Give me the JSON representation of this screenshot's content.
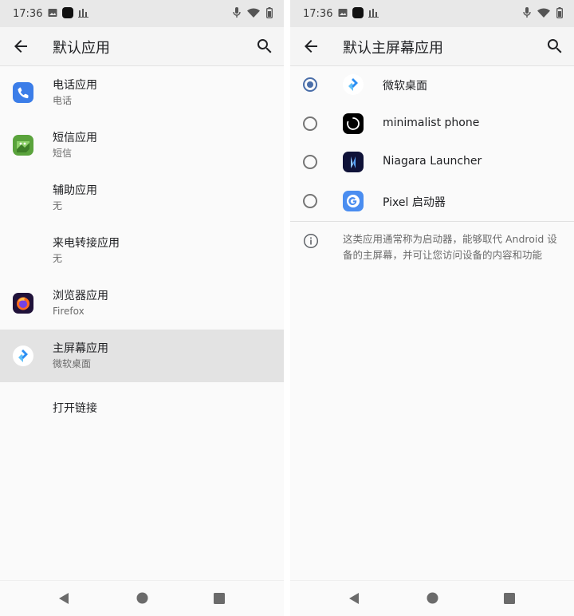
{
  "status_bar": {
    "time": "17:36"
  },
  "left": {
    "title": "默认应用",
    "items": [
      {
        "primary": "电话应用",
        "secondary": "电话",
        "icon": "phone-app-icon"
      },
      {
        "primary": "短信应用",
        "secondary": "短信",
        "icon": "messages-app-icon"
      },
      {
        "primary": "辅助应用",
        "secondary": "无"
      },
      {
        "primary": "来电转接应用",
        "secondary": "无"
      },
      {
        "primary": "浏览器应用",
        "secondary": "Firefox",
        "icon": "firefox-icon"
      },
      {
        "primary": "主屏幕应用",
        "secondary": "微软桌面",
        "icon": "microsoft-launcher-icon",
        "selected": true
      },
      {
        "primary": "打开链接"
      }
    ]
  },
  "right": {
    "title": "默认主屏幕应用",
    "options": [
      {
        "label": "微软桌面",
        "checked": true,
        "icon": "microsoft-launcher-icon"
      },
      {
        "label": "minimalist phone",
        "checked": false,
        "icon": "minimalist-phone-icon"
      },
      {
        "label": "Niagara Launcher",
        "checked": false,
        "icon": "niagara-launcher-icon"
      },
      {
        "label": "Pixel 启动器",
        "checked": false,
        "icon": "pixel-launcher-icon"
      }
    ],
    "info_text": "这类应用通常称为启动器，能够取代 Android 设备的主屏幕，并可让您访问设备的内容和功能"
  },
  "colors": {
    "accent": "#4a6ea9",
    "selected_row": "#e3e3e3"
  }
}
